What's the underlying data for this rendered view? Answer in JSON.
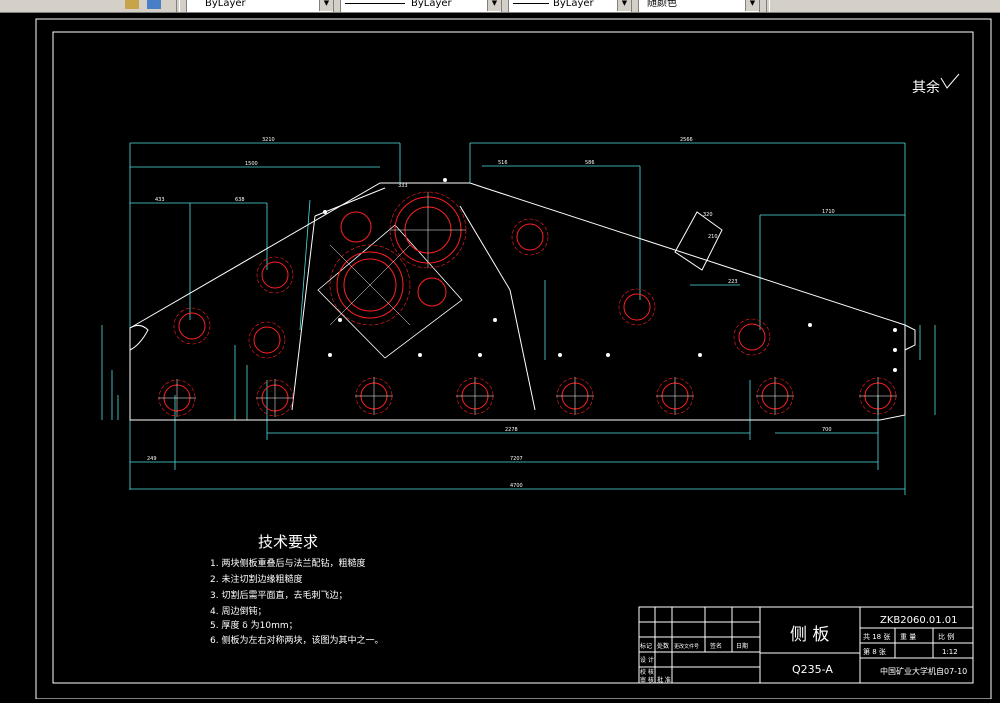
{
  "toolbar": {
    "color_combo": "ByLayer",
    "linetype_combo": "ByLayer",
    "lineweight_combo": "ByLayer",
    "plotstyle_combo": "随颜色"
  },
  "drawing": {
    "surface_note": "其余",
    "tech_title": "技术要求",
    "tech_items": [
      "1. 两块侧板重叠后与法兰配钻，粗糙度",
      "2. 未注切割边缘粗糙度",
      "3. 切割后需平面直，去毛刺飞边；",
      "4.  周边倒钝；",
      "5.  厚度 δ 为10mm；",
      "6. 侧板为左右对称两块，该图为其中之一。"
    ],
    "dims": {
      "top_left": "3210",
      "top_right": "2566",
      "upper_left": "1500",
      "mid_left": "433",
      "mid_left2": "638",
      "hub_dim": "333",
      "slot_a": "516",
      "slot_b": "586",
      "right_width": "1710",
      "span_mid": "2278",
      "span_right": "700",
      "span_left": "249",
      "span_total_holes": "7207",
      "overall": "4700",
      "rect_a": "320",
      "rect_b": "210",
      "right_hole_dim": "223"
    },
    "title_block": {
      "part_name": "侧 板",
      "material": "Q235-A",
      "drawing_no": "ZKB2060.01.01",
      "sheet_total": "共 18 张",
      "sheet_no": "第 8 张",
      "weight_label": "重 量",
      "scale_label": "比 例",
      "scale": "1:12",
      "school": "中国矿业大学机自07-10",
      "label_mark": "标记",
      "label_count": "处数",
      "label_change": "更改文件号",
      "label_sign": "签名",
      "label_date": "日期",
      "label_design": "设 计",
      "label_check": "校 核",
      "label_audit": "审 核",
      "label_approve": "批 准"
    }
  }
}
